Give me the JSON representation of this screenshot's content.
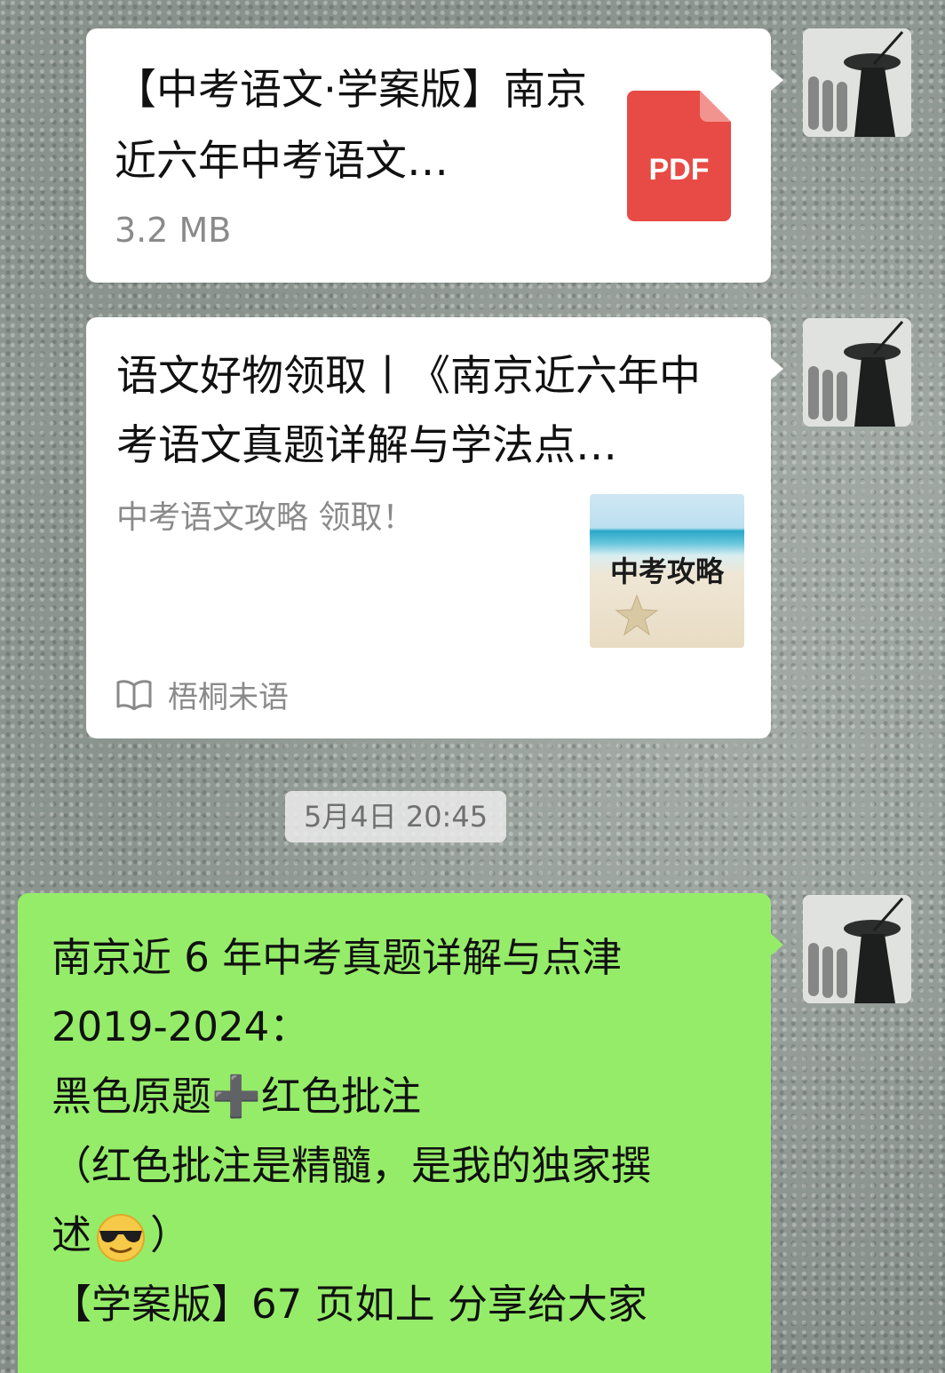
{
  "file_message": {
    "title": "【中考语文·学案版】南京近六年中考语文…",
    "size": "3.2 MB",
    "icon_label": "PDF",
    "icon": "pdf-file-icon"
  },
  "article_message": {
    "title": "语文好物领取丨《南京近六年中考语文真题详解与学法点…",
    "description": "中考语文攻略 领取！",
    "thumbnail_text": "中考攻略",
    "source": "梧桐未语",
    "source_icon": "book-icon"
  },
  "timestamp": "5月4日 20:45",
  "text_message": {
    "lines": [
      "南京近 6 年中考真题详解与点津",
      "2019-2024：",
      "黑色原题➕红色批注",
      "（红色批注是精髓，是我的独家撰",
      "述",
      "）",
      "【学案版】67 页如上 分享给大家"
    ],
    "emoji": "sunglasses-emoji"
  },
  "colors": {
    "bubble_white": "#ffffff",
    "bubble_green": "#95ec69",
    "pdf_red": "#e84a45",
    "muted_text": "#8a8a8a"
  }
}
